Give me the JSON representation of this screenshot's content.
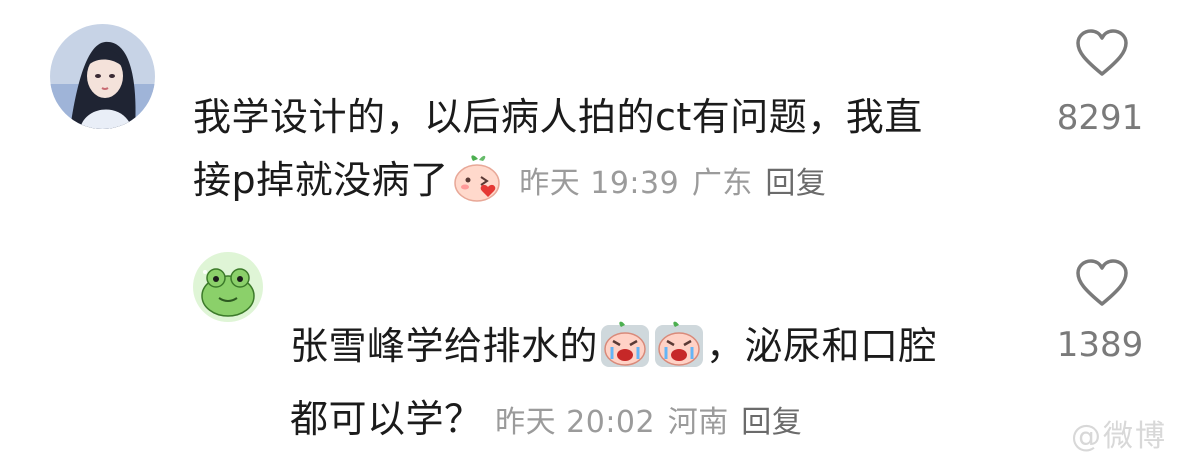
{
  "comments": [
    {
      "text_line1": "我学设计的，以后病人拍的ct有问题，我直",
      "text_line2": "接p掉就没病了",
      "time": "昨天 19:39",
      "location": "广东",
      "reply_label": "回复",
      "likes": "8291",
      "emoji_icons": [
        "blush-peach-emoji-icon"
      ]
    },
    {
      "text_line1_a": "张雪峰学给排水的",
      "text_line1_b": "，泌尿和口腔",
      "text_line2": "都可以学？",
      "time": "昨天 20:02",
      "location": "河南",
      "reply_label": "回复",
      "likes": "1389",
      "emoji_icons": [
        "crying-peach-emoji-icon",
        "crying-peach-emoji-icon"
      ]
    }
  ],
  "watermark": "@微博"
}
